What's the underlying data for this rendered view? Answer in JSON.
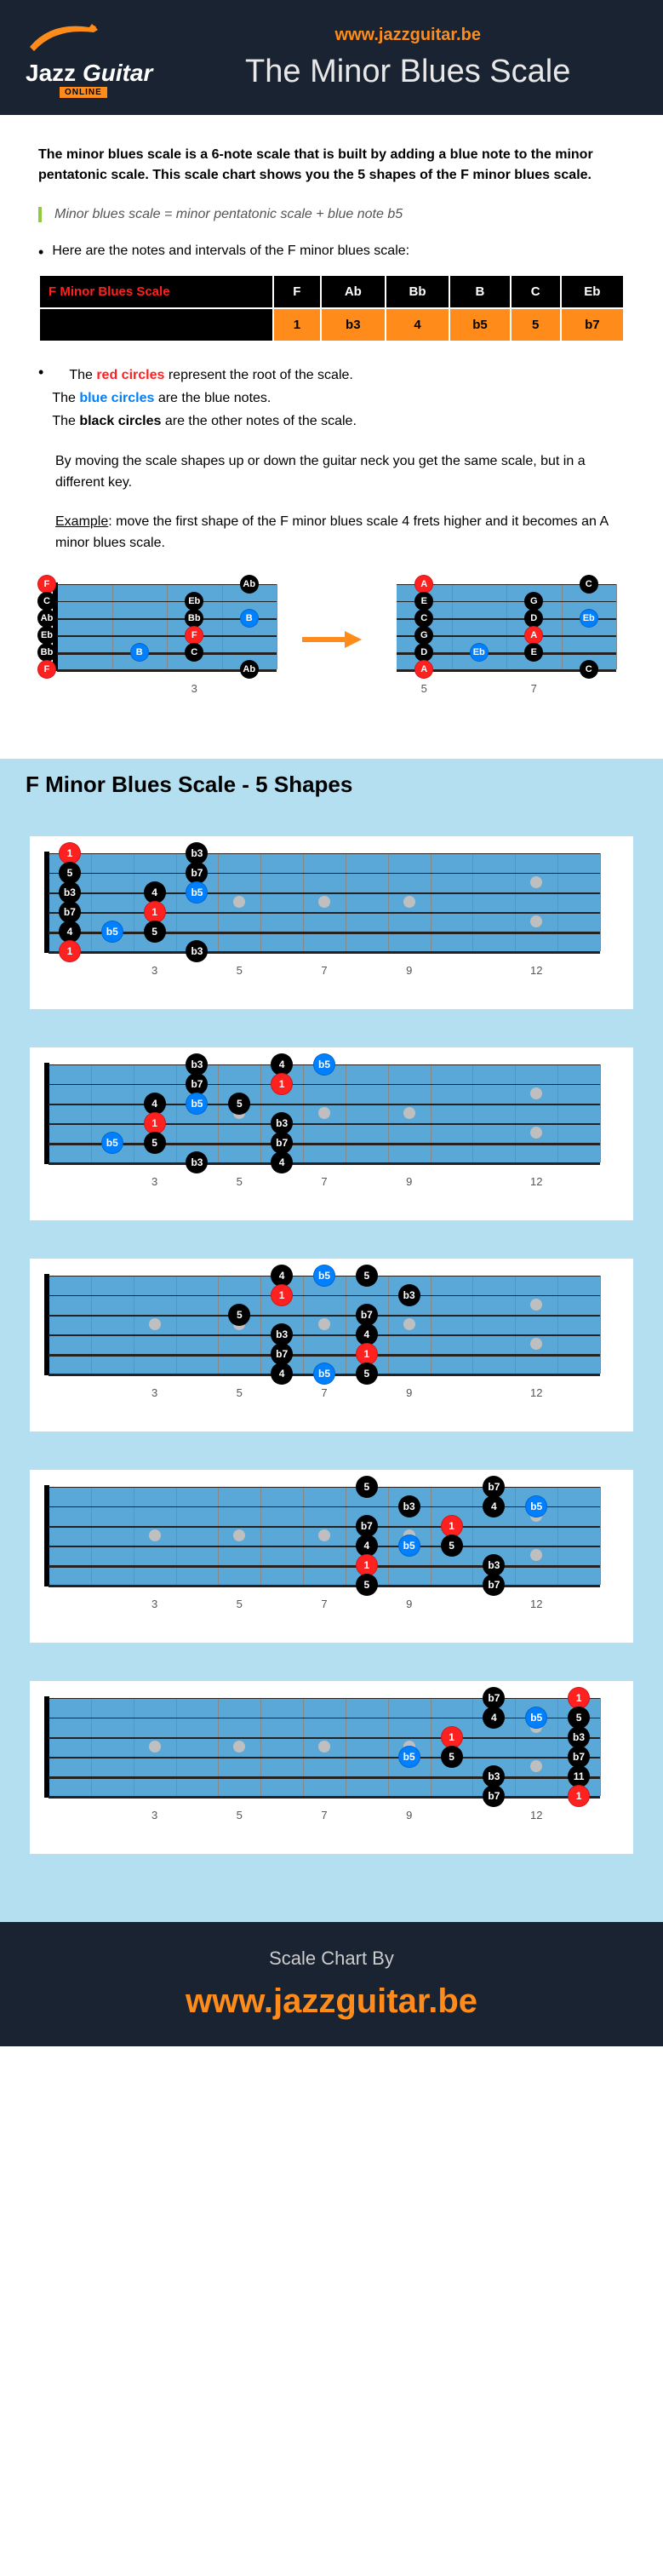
{
  "header": {
    "site_url": "www.jazzguitar.be",
    "page_title": "The Minor Blues Scale",
    "logo_brand_a": "Jazz",
    "logo_brand_b": "Guitar",
    "logo_tag": "ONLINE"
  },
  "intro": "The minor blues scale is a 6-note scale that is built by adding a blue note to the minor pentatonic scale. This scale chart shows you the 5 shapes of the F minor blues scale.",
  "quote": "Minor blues scale = minor pentatonic scale + blue note b5",
  "bullet1": "Here are the notes and intervals of the F minor blues scale:",
  "table": {
    "title": "F Minor Blues Scale",
    "notes": [
      "F",
      "Ab",
      "Bb",
      "B",
      "C",
      "Eb"
    ],
    "intervals": [
      "1",
      "b3",
      "4",
      "b5",
      "5",
      "b7"
    ]
  },
  "legend": {
    "l1a": "The ",
    "l1b": "red circles",
    "l1c": " represent the root of the scale.",
    "l2a": "The ",
    "l2b": "blue circles",
    "l2c": " are the blue notes.",
    "l3a": "The ",
    "l3b": "black circles",
    "l3c": " are the other notes of the scale."
  },
  "shift_text": "By moving the scale shapes up or down the guitar neck you get the same scale, but in a different key.",
  "example_label": "Example",
  "example_text": ": move the first shape of the F minor blues scale 4 frets higher and it becomes an A minor blues scale.",
  "example_fb1": {
    "fret_labels": [
      {
        "f": 3,
        "t": "3"
      }
    ],
    "dots": [
      {
        "s": 1,
        "f": 0,
        "t": "F",
        "c": "red"
      },
      {
        "s": 1,
        "f": 4,
        "t": "Ab",
        "c": "black"
      },
      {
        "s": 2,
        "f": 0,
        "t": "C",
        "c": "black"
      },
      {
        "s": 2,
        "f": 3,
        "t": "Eb",
        "c": "black"
      },
      {
        "s": 3,
        "f": 0,
        "t": "Ab",
        "c": "black"
      },
      {
        "s": 3,
        "f": 3,
        "t": "Bb",
        "c": "black"
      },
      {
        "s": 3,
        "f": 4,
        "t": "B",
        "c": "blue"
      },
      {
        "s": 4,
        "f": 0,
        "t": "Eb",
        "c": "black"
      },
      {
        "s": 4,
        "f": 3,
        "t": "F",
        "c": "red"
      },
      {
        "s": 5,
        "f": 0,
        "t": "Bb",
        "c": "black"
      },
      {
        "s": 5,
        "f": 2,
        "t": "B",
        "c": "blue"
      },
      {
        "s": 5,
        "f": 3,
        "t": "C",
        "c": "black"
      },
      {
        "s": 6,
        "f": 0,
        "t": "F",
        "c": "red"
      },
      {
        "s": 6,
        "f": 4,
        "t": "Ab",
        "c": "black"
      }
    ],
    "num_frets": 4,
    "show_nut": true
  },
  "example_fb2": {
    "fret_labels": [
      {
        "f": 1,
        "t": "5"
      },
      {
        "f": 3,
        "t": "7"
      }
    ],
    "dots": [
      {
        "s": 1,
        "f": 1,
        "t": "A",
        "c": "red"
      },
      {
        "s": 1,
        "f": 4,
        "t": "C",
        "c": "black"
      },
      {
        "s": 2,
        "f": 1,
        "t": "E",
        "c": "black"
      },
      {
        "s": 2,
        "f": 3,
        "t": "G",
        "c": "black"
      },
      {
        "s": 3,
        "f": 1,
        "t": "C",
        "c": "black"
      },
      {
        "s": 3,
        "f": 3,
        "t": "D",
        "c": "black"
      },
      {
        "s": 3,
        "f": 4,
        "t": "Eb",
        "c": "blue"
      },
      {
        "s": 4,
        "f": 1,
        "t": "G",
        "c": "black"
      },
      {
        "s": 4,
        "f": 3,
        "t": "A",
        "c": "red"
      },
      {
        "s": 5,
        "f": 1,
        "t": "D",
        "c": "black"
      },
      {
        "s": 5,
        "f": 2,
        "t": "Eb",
        "c": "blue"
      },
      {
        "s": 5,
        "f": 3,
        "t": "E",
        "c": "black"
      },
      {
        "s": 6,
        "f": 1,
        "t": "A",
        "c": "red"
      },
      {
        "s": 6,
        "f": 4,
        "t": "C",
        "c": "black"
      }
    ],
    "num_frets": 4,
    "show_nut": false
  },
  "section_title": "F Minor Blues Scale - 5 Shapes",
  "fret_numbers": [
    3,
    5,
    7,
    9,
    12
  ],
  "inlays_single": [
    3,
    5,
    7,
    9
  ],
  "inlay_double": 12,
  "shapes": [
    {
      "dots": [
        {
          "s": 1,
          "f": 1,
          "t": "1",
          "c": "red"
        },
        {
          "s": 1,
          "f": 4,
          "t": "b3",
          "c": "black"
        },
        {
          "s": 2,
          "f": 1,
          "t": "5",
          "c": "black"
        },
        {
          "s": 2,
          "f": 4,
          "t": "b7",
          "c": "black"
        },
        {
          "s": 3,
          "f": 1,
          "t": "b3",
          "c": "black"
        },
        {
          "s": 3,
          "f": 3,
          "t": "4",
          "c": "black"
        },
        {
          "s": 3,
          "f": 4,
          "t": "b5",
          "c": "blue"
        },
        {
          "s": 4,
          "f": 1,
          "t": "b7",
          "c": "black"
        },
        {
          "s": 4,
          "f": 3,
          "t": "1",
          "c": "red"
        },
        {
          "s": 5,
          "f": 1,
          "t": "4",
          "c": "black"
        },
        {
          "s": 5,
          "f": 2,
          "t": "b5",
          "c": "blue"
        },
        {
          "s": 5,
          "f": 3,
          "t": "5",
          "c": "black"
        },
        {
          "s": 6,
          "f": 1,
          "t": "1",
          "c": "red"
        },
        {
          "s": 6,
          "f": 4,
          "t": "b3",
          "c": "black"
        }
      ]
    },
    {
      "dots": [
        {
          "s": 1,
          "f": 4,
          "t": "b3",
          "c": "black"
        },
        {
          "s": 1,
          "f": 6,
          "t": "4",
          "c": "black"
        },
        {
          "s": 1,
          "f": 7,
          "t": "b5",
          "c": "blue"
        },
        {
          "s": 2,
          "f": 4,
          "t": "b7",
          "c": "black"
        },
        {
          "s": 2,
          "f": 6,
          "t": "1",
          "c": "red"
        },
        {
          "s": 3,
          "f": 3,
          "t": "4",
          "c": "black"
        },
        {
          "s": 3,
          "f": 4,
          "t": "b5",
          "c": "blue"
        },
        {
          "s": 3,
          "f": 5,
          "t": "5",
          "c": "black"
        },
        {
          "s": 4,
          "f": 3,
          "t": "1",
          "c": "red"
        },
        {
          "s": 4,
          "f": 6,
          "t": "b3",
          "c": "black"
        },
        {
          "s": 5,
          "f": 2,
          "t": "b5",
          "c": "blue"
        },
        {
          "s": 5,
          "f": 3,
          "t": "5",
          "c": "black"
        },
        {
          "s": 5,
          "f": 6,
          "t": "b7",
          "c": "black"
        },
        {
          "s": 6,
          "f": 4,
          "t": "b3",
          "c": "black"
        },
        {
          "s": 6,
          "f": 6,
          "t": "4",
          "c": "black"
        }
      ]
    },
    {
      "dots": [
        {
          "s": 1,
          "f": 6,
          "t": "4",
          "c": "black"
        },
        {
          "s": 1,
          "f": 7,
          "t": "b5",
          "c": "blue"
        },
        {
          "s": 1,
          "f": 8,
          "t": "5",
          "c": "black"
        },
        {
          "s": 2,
          "f": 6,
          "t": "1",
          "c": "red"
        },
        {
          "s": 2,
          "f": 9,
          "t": "b3",
          "c": "black"
        },
        {
          "s": 3,
          "f": 5,
          "t": "5",
          "c": "black"
        },
        {
          "s": 3,
          "f": 8,
          "t": "b7",
          "c": "black"
        },
        {
          "s": 4,
          "f": 6,
          "t": "b3",
          "c": "black"
        },
        {
          "s": 4,
          "f": 8,
          "t": "4",
          "c": "black"
        },
        {
          "s": 5,
          "f": 6,
          "t": "b7",
          "c": "black"
        },
        {
          "s": 5,
          "f": 8,
          "t": "1",
          "c": "red"
        },
        {
          "s": 6,
          "f": 6,
          "t": "4",
          "c": "black"
        },
        {
          "s": 6,
          "f": 7,
          "t": "b5",
          "c": "blue"
        },
        {
          "s": 6,
          "f": 8,
          "t": "5",
          "c": "black"
        }
      ]
    },
    {
      "dots": [
        {
          "s": 1,
          "f": 8,
          "t": "5",
          "c": "black"
        },
        {
          "s": 1,
          "f": 11,
          "t": "b7",
          "c": "black"
        },
        {
          "s": 2,
          "f": 9,
          "t": "b3",
          "c": "black"
        },
        {
          "s": 2,
          "f": 11,
          "t": "4",
          "c": "black"
        },
        {
          "s": 2,
          "f": 12,
          "t": "b5",
          "c": "blue"
        },
        {
          "s": 3,
          "f": 8,
          "t": "b7",
          "c": "black"
        },
        {
          "s": 3,
          "f": 10,
          "t": "1",
          "c": "red"
        },
        {
          "s": 4,
          "f": 8,
          "t": "4",
          "c": "black"
        },
        {
          "s": 4,
          "f": 9,
          "t": "b5",
          "c": "blue"
        },
        {
          "s": 4,
          "f": 10,
          "t": "5",
          "c": "black"
        },
        {
          "s": 5,
          "f": 8,
          "t": "1",
          "c": "red"
        },
        {
          "s": 5,
          "f": 11,
          "t": "b3",
          "c": "black"
        },
        {
          "s": 6,
          "f": 8,
          "t": "5",
          "c": "black"
        },
        {
          "s": 6,
          "f": 11,
          "t": "b7",
          "c": "black"
        }
      ]
    },
    {
      "dots": [
        {
          "s": 1,
          "f": 11,
          "t": "b7",
          "c": "black"
        },
        {
          "s": 1,
          "f": 13,
          "t": "1",
          "c": "red"
        },
        {
          "s": 2,
          "f": 11,
          "t": "4",
          "c": "black"
        },
        {
          "s": 2,
          "f": 12,
          "t": "b5",
          "c": "blue"
        },
        {
          "s": 2,
          "f": 13,
          "t": "5",
          "c": "black"
        },
        {
          "s": 3,
          "f": 10,
          "t": "1",
          "c": "red"
        },
        {
          "s": 3,
          "f": 13,
          "t": "b3",
          "c": "black"
        },
        {
          "s": 4,
          "f": 9,
          "t": "b5",
          "c": "blue"
        },
        {
          "s": 4,
          "f": 10,
          "t": "5",
          "c": "black"
        },
        {
          "s": 4,
          "f": 13,
          "t": "b7",
          "c": "black"
        },
        {
          "s": 5,
          "f": 11,
          "t": "b3",
          "c": "black"
        },
        {
          "s": 5,
          "f": 13,
          "t": "11",
          "c": "black"
        },
        {
          "s": 6,
          "f": 11,
          "t": "b7",
          "c": "black"
        },
        {
          "s": 6,
          "f": 13,
          "t": "1",
          "c": "red"
        }
      ]
    }
  ],
  "footer": {
    "label": "Scale Chart By",
    "url": "www.jazzguitar.be"
  }
}
